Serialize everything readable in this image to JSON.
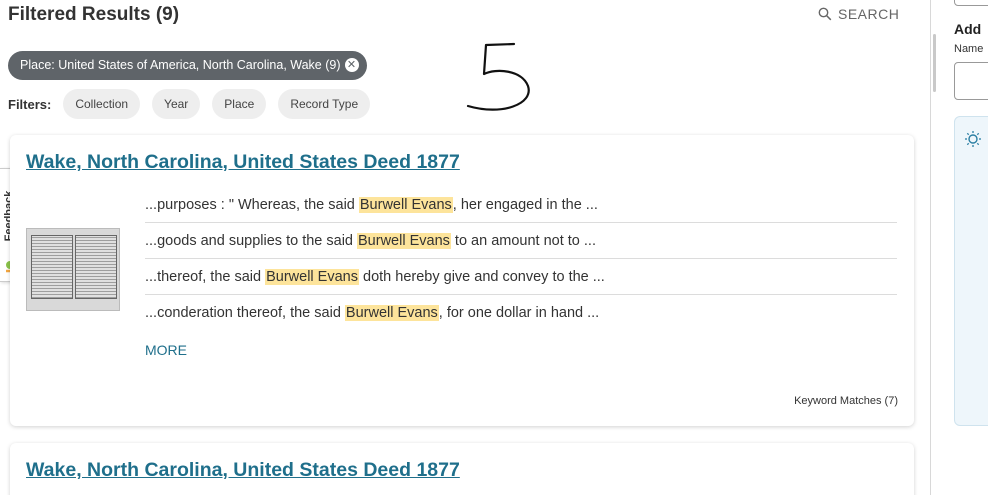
{
  "header": {
    "title": "Filtered Results (9)",
    "search_label": "SEARCH"
  },
  "applied_filter": {
    "label": "Place: United States of America, North Carolina, Wake (9)"
  },
  "filters": {
    "label": "Filters:",
    "chips": [
      "Collection",
      "Year",
      "Place",
      "Record Type"
    ]
  },
  "feedback": {
    "label": "Feedback"
  },
  "results": [
    {
      "title": "Wake, North Carolina, United States Deed 1877",
      "snippets": [
        {
          "before": "...purposes : \" Whereas, the said ",
          "highlight": "Burwell Evans",
          "after": ", her engaged in the ..."
        },
        {
          "before": "...goods and supplies to the said ",
          "highlight": "Burwell Evans",
          "after": " to an amount not to ..."
        },
        {
          "before": "...thereof, the said ",
          "highlight": "Burwell Evans",
          "after": " doth hereby give and convey to the ..."
        },
        {
          "before": "...conderation thereof, the said ",
          "highlight": "Burwell Evans",
          "after": ", for one dollar in hand ..."
        }
      ],
      "more_label": "MORE",
      "keyword_matches": "Keyword Matches (7)"
    },
    {
      "title": "Wake, North Carolina, United States Deed 1877"
    }
  ],
  "right_panel": {
    "heading": "Add",
    "name_label": "Name"
  },
  "annotation": {
    "text": "5"
  },
  "colors": {
    "link": "#1f6f8b",
    "highlight": "#fde49b",
    "chip_dark": "#5f6469"
  }
}
